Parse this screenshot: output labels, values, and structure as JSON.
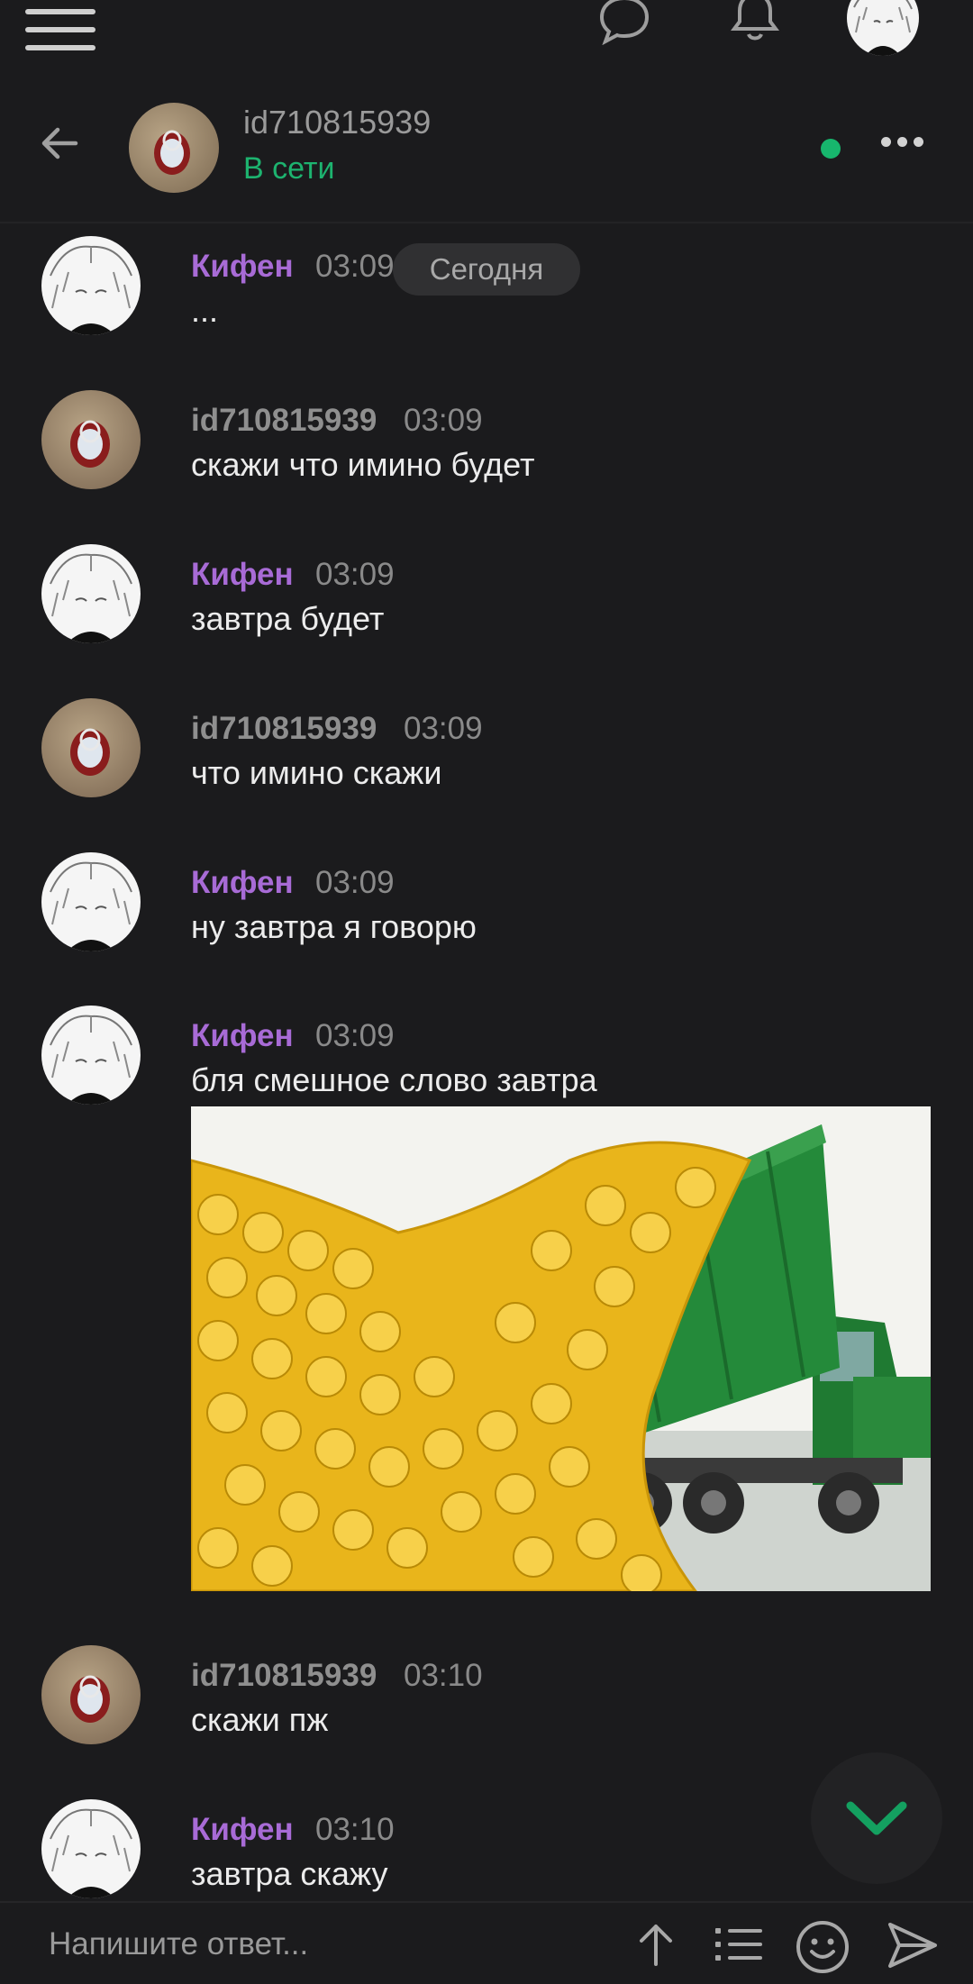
{
  "topbar": {
    "menu_icon": "hamburger-icon",
    "chat_icon": "chat-bubble-icon",
    "bell_icon": "bell-icon",
    "profile_avatar": "user-avatar"
  },
  "header": {
    "name": "id710815939",
    "status": "В сети",
    "back_icon": "arrow-left-icon",
    "more_icon": "more-horizontal-icon",
    "status_color": "#1db36f"
  },
  "date_divider": "Сегодня",
  "colors": {
    "kifen_name": "#a86bd6",
    "id_name": "#8f8f8f",
    "accent_green": "#17b66d"
  },
  "messages": [
    {
      "author": "Кифен",
      "time": "03:09",
      "text": "..."
    },
    {
      "author": "id710815939",
      "time": "03:09",
      "text": "скажи что имино будет"
    },
    {
      "author": "Кифен",
      "time": "03:09",
      "text": "завтра будет"
    },
    {
      "author": "id710815939",
      "time": "03:09",
      "text": "что имино скажи"
    },
    {
      "author": "Кифен",
      "time": "03:09",
      "text": "ну завтра я говорю"
    },
    {
      "author": "Кифен",
      "time": "03:09",
      "text": "бля смешное слово завтра"
    },
    {
      "author": "id710815939",
      "time": "03:10",
      "text": "скажи пж"
    },
    {
      "author": "Кифен",
      "time": "03:10",
      "text": "завтра скажу"
    }
  ],
  "composer": {
    "placeholder": "Напишите ответ...",
    "icons": [
      "arrow-up-icon",
      "list-icon",
      "emoji-icon",
      "send-icon"
    ]
  }
}
